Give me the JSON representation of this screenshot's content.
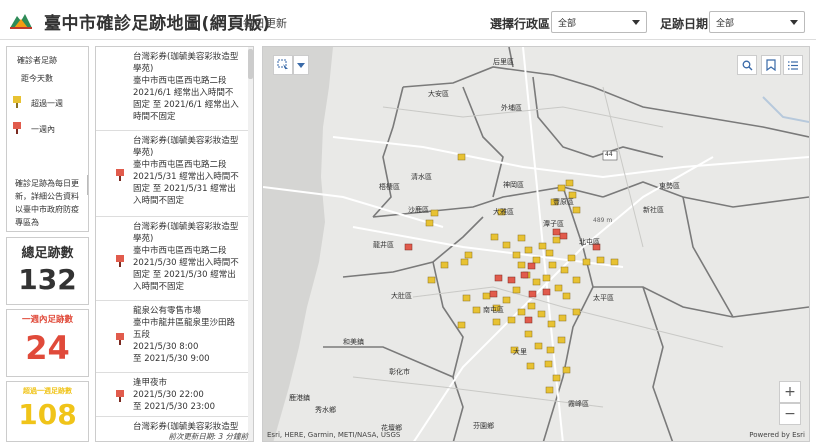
{
  "header": {
    "title": "臺中市確診足跡地圖(網頁版)",
    "subtitle": "每日更新",
    "district_label": "選擇行政區",
    "district_value": "全部",
    "date_label": "足跡日期",
    "date_value": "全部"
  },
  "legend": {
    "title": "確診者足跡",
    "sub": "距今天數",
    "items": [
      {
        "label": "超過一週",
        "color": "#e8c232"
      },
      {
        "label": "一週內",
        "color": "#e15b4c"
      }
    ],
    "description": "確診足跡為每日更新，詳細公告資料以臺中市政府防疫專區為"
  },
  "stats": [
    {
      "label": "總足跡數",
      "value": "132",
      "label_color": "#333333",
      "value_color": "#333333"
    },
    {
      "label": "一週內足跡數",
      "value": "24",
      "label_color": "#e04a3a",
      "value_color": "#e04a3a"
    },
    {
      "label": "超過一週足跡數",
      "value": "108",
      "label_color": "#f0c419",
      "value_color": "#f0c419"
    }
  ],
  "list": [
    {
      "lines": [
        "台灣彩券(珈毓美容彩妝造型",
        "學苑)",
        "臺中市西屯區西屯路二段",
        "2021/6/1 經常出入時間不",
        "固定 至 2021/6/1 經常出入",
        "時間不固定"
      ],
      "pin": "yellow"
    },
    {
      "lines": [
        "台灣彩券(珈毓美容彩妝造型",
        "學苑)",
        "臺中市西屯區西屯路二段",
        "2021/5/31 經常出入時間不",
        "固定 至 2021/5/31 經常出",
        "入時間不固定"
      ],
      "pin": "red"
    },
    {
      "lines": [
        "台灣彩券(珈毓美容彩妝造型",
        "學苑)",
        "臺中市西屯區西屯路二段",
        "2021/5/30 經常出入時間不",
        "固定 至 2021/5/30 經常出",
        "入時間不固定"
      ],
      "pin": "red"
    },
    {
      "lines": [
        "龍泉公有零售市場",
        "臺中市龍井區龍泉里沙田路",
        "五段",
        "2021/5/30 8:00",
        "至 2021/5/30 9:00"
      ],
      "pin": "red"
    },
    {
      "lines": [
        "逢甲夜市",
        "2021/5/30 22:00",
        "至 2021/5/30 23:00"
      ],
      "pin": "red"
    },
    {
      "lines": [
        "台灣彩券(珈毓美容彩妝造型"
      ],
      "pin": "red"
    }
  ],
  "list_footer": "前次更新日期: 3 分鐘前",
  "map": {
    "attribution": "Esri, HERE, Garmin, METI/NASA, USGS",
    "powered": "Powered by Esri",
    "places": [
      {
        "name": "大安區"
      },
      {
        "name": "后里區"
      },
      {
        "name": "外埔區"
      },
      {
        "name": "清水區"
      },
      {
        "name": "梧棲區"
      },
      {
        "name": "神岡區"
      },
      {
        "name": "豐原區"
      },
      {
        "name": "沙鹿區"
      },
      {
        "name": "大雅區"
      },
      {
        "name": "東勢區"
      },
      {
        "name": "新社區"
      },
      {
        "name": "龍井區"
      },
      {
        "name": "大肚區"
      },
      {
        "name": "南屯區"
      },
      {
        "name": "太平區"
      },
      {
        "name": "和美鎮"
      },
      {
        "name": "大里"
      },
      {
        "name": "彰化市"
      },
      {
        "name": "霧峰區"
      },
      {
        "name": "鹿港鎮"
      },
      {
        "name": "芬園鄉"
      },
      {
        "name": "秀水鄉"
      },
      {
        "name": "花壇鄉"
      },
      {
        "name": "潭子區"
      },
      {
        "name": "北屯區"
      }
    ],
    "route_label": "44",
    "elev_label": "489 m",
    "zoom_in": "+",
    "zoom_out": "−"
  }
}
